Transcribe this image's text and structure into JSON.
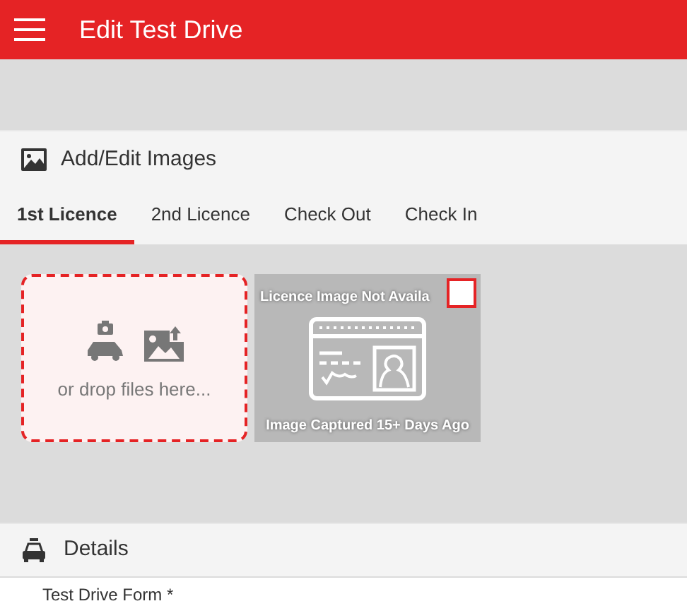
{
  "app_bar": {
    "title": "Edit Test Drive"
  },
  "images_panel": {
    "title": "Add/Edit Images",
    "tabs": [
      {
        "label": "1st Licence",
        "selected": true
      },
      {
        "label": "2nd Licence",
        "selected": false
      },
      {
        "label": "Check Out",
        "selected": false
      },
      {
        "label": "Check In",
        "selected": false
      }
    ],
    "drop_zone": {
      "text": "or drop files here..."
    },
    "image_tile": {
      "caption_top": "Licence Image Not Availa",
      "caption_bottom": "Image Captured 15+ Days Ago",
      "checked": false
    }
  },
  "details_panel": {
    "title": "Details",
    "field_label": "Test Drive Form *"
  }
}
